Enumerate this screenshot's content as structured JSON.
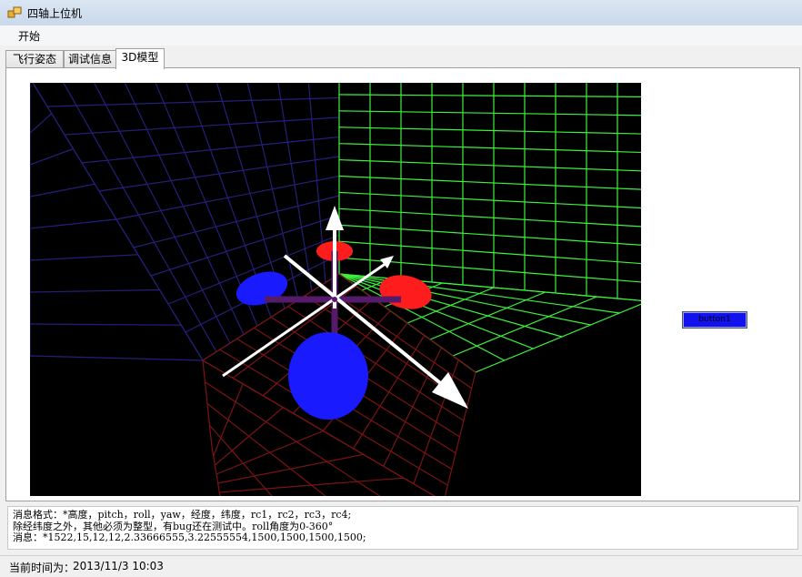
{
  "window": {
    "title": "四轴上位机"
  },
  "menu": {
    "items": [
      {
        "label": "开始"
      }
    ]
  },
  "tabs": [
    {
      "label": "飞行姿态",
      "active": false
    },
    {
      "label": "调试信息",
      "active": false
    },
    {
      "label": "3D模型",
      "active": true
    }
  ],
  "viewport": {
    "background": "#000000",
    "grid_colors": {
      "left_wall": "#22207a",
      "right_wall": "#3cf23c",
      "floor": "#7a1414"
    },
    "arm_color": "#551a6a",
    "motor_colors": {
      "front": "#ff1c1c",
      "right": "#ff1c1c",
      "left": "#1a1aff",
      "back": "#1a1aff"
    },
    "axis_color": "#ffffff"
  },
  "side_button": {
    "label": "button1",
    "color": "#1212ee"
  },
  "messages": [
    "消息格式：*高度，pitch，roll，yaw，经度，纬度，rc1，rc2，rc3，rc4;",
    "除经纬度之外，其他必须为整型，有bug还在测试中。roll角度为0-360°",
    "消息：*1522,15,12,12,2.33666555,3.22555554,1500,1500,1500,1500;"
  ],
  "status": {
    "label": "当前时间为：",
    "value": "2013/11/3   10:03"
  }
}
